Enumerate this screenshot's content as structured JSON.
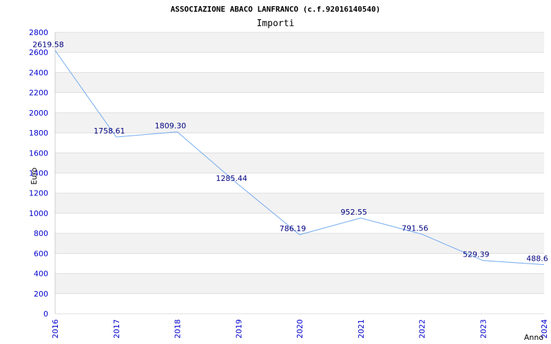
{
  "chart_data": {
    "type": "line",
    "title": "ASSOCIAZIONE ABACO LANFRANCO (c.f.92016140540)",
    "subtitle": "Importi",
    "xlabel": "Anno",
    "ylabel": "Euro",
    "categories": [
      "2016",
      "2017",
      "2018",
      "2019",
      "2020",
      "2021",
      "2022",
      "2023",
      "2024"
    ],
    "series": [
      {
        "values": [
          2619.58,
          1758.61,
          1809.3,
          1285.44,
          786.19,
          952.55,
          791.56,
          529.39,
          488.6
        ],
        "labels": [
          "2619.58",
          "1758.61",
          "1809.30",
          "1285.44",
          "786.19",
          "952.55",
          "791.56",
          "529.39",
          "488.6"
        ]
      }
    ],
    "ylim": [
      0,
      2800
    ],
    "yticks": [
      "0",
      "200",
      "400",
      "600",
      "800",
      "1000",
      "1200",
      "1400",
      "1600",
      "1800",
      "2000",
      "2200",
      "2400",
      "2600",
      "2800"
    ],
    "grid": true,
    "colors": {
      "line": "#6fa8f0",
      "band_a": "#f2f2f2",
      "band_b": "#ffffff",
      "gridline": "#dddddd",
      "tick_text": "#0000cc",
      "label_text": "#000080"
    }
  }
}
